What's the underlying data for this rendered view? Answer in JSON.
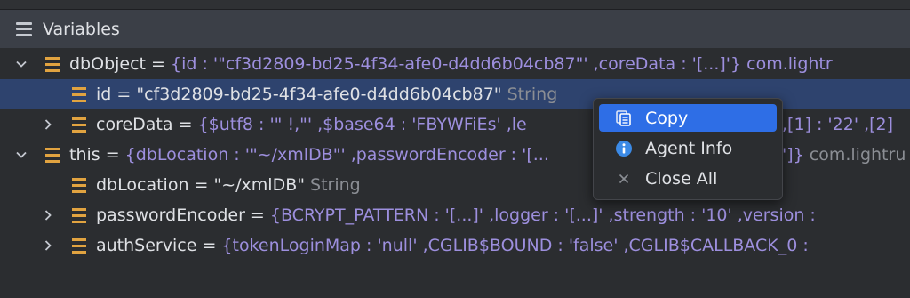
{
  "panel": {
    "title": "Variables"
  },
  "rows": [
    {
      "name": "dbObject",
      "eq": " = ",
      "value": "{id : '\"cf3d2809-bd25-4f34-afe0-d4dd6b04cb87\"' ,coreData : '[...]'} com.lightr",
      "type": ""
    },
    {
      "name": "id",
      "eq": " = ",
      "value": "\"cf3d2809-bd25-4f34-afe0-d4dd6b04cb87\"",
      "type": " String"
    },
    {
      "name": "coreData",
      "eq": " = ",
      "value": "{$utf8 : '\"     !,\"' ,$base64 : 'FBYWFiEs' ,le",
      "value2": ",[1] : '22' ,[2]",
      "type": ""
    },
    {
      "name": "this",
      "eq": " = ",
      "value": "{dbLocation : '\"~/xmlDB\"' ,passwordEncoder : '[...",
      "value2": "']}",
      "type": " com.lightru"
    },
    {
      "name": "dbLocation",
      "eq": " = ",
      "value": "\"~/xmlDB\"",
      "type": " String"
    },
    {
      "name": "passwordEncoder",
      "eq": " = ",
      "value": "{BCRYPT_PATTERN : '[...]' ,logger : '[...]' ,strength : '10' ,version :",
      "type": ""
    },
    {
      "name": "authService",
      "eq": " = ",
      "value": "{tokenLoginMap : 'null' ,CGLIB$BOUND : 'false' ,CGLIB$CALLBACK_0 : ",
      "type": ""
    }
  ],
  "context_menu": {
    "items": [
      {
        "label": "Copy",
        "icon": "copy-icon"
      },
      {
        "label": "Agent Info",
        "icon": "info-icon"
      },
      {
        "label": "Close All",
        "icon": "close-icon"
      }
    ]
  },
  "colors": {
    "background": "#2b2d30",
    "header": "#3b3f47",
    "selection": "#2e436e",
    "menu_highlight": "#2e6ee6",
    "value": "#9d8fde",
    "field_icon": "#e1a340"
  }
}
